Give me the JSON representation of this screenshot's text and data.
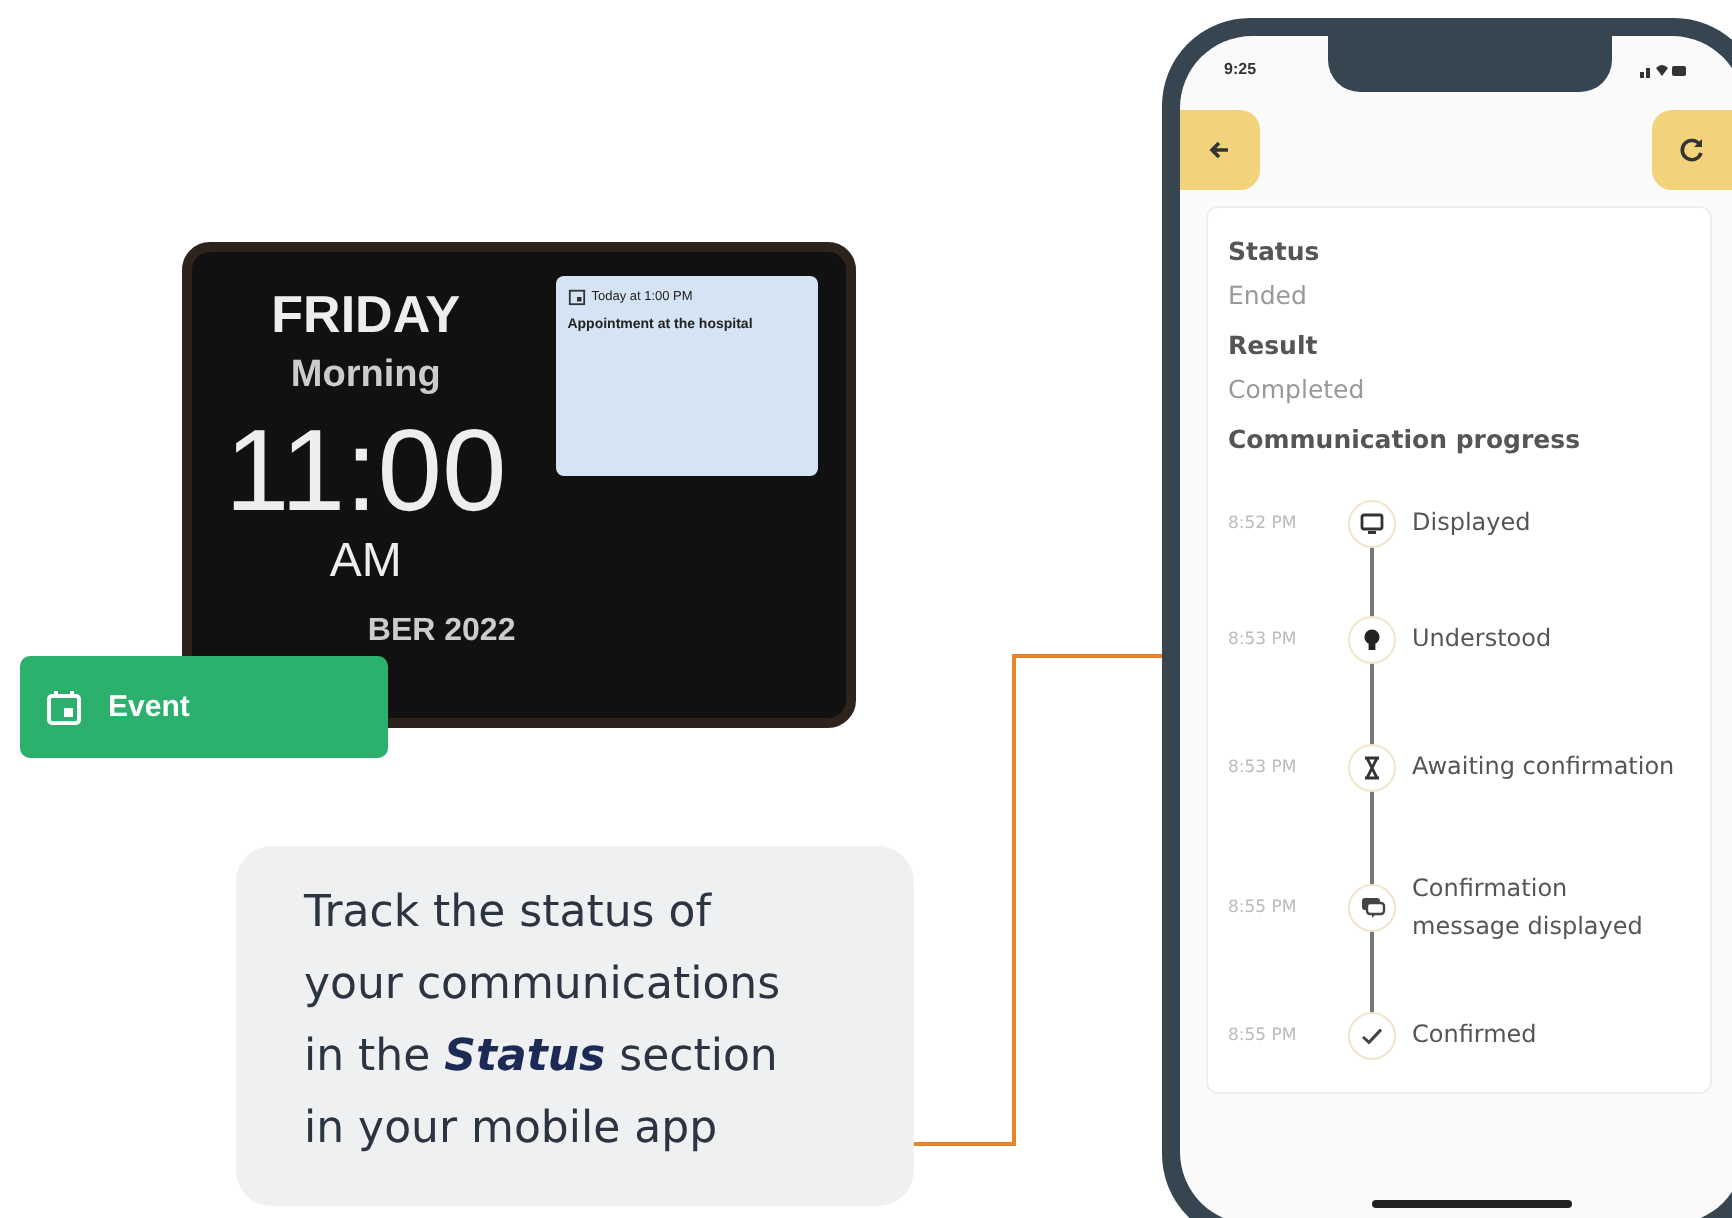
{
  "tablet": {
    "day": "FRIDAY",
    "period": "Morning",
    "time": "11:00",
    "meridiem": "AM",
    "date": "BER 2022",
    "event": {
      "when": "Today at 1:00 PM",
      "title": "Appointment at the hospital"
    }
  },
  "event_badge": {
    "label": "Event"
  },
  "callout": {
    "text": "Track the status of your communications in the **Status** section in your mobile app"
  },
  "phone": {
    "clock": "9:25",
    "fields": [
      {
        "label": "Status",
        "value": "Ended"
      },
      {
        "label": "Result",
        "value": "Completed"
      }
    ],
    "progress_title": "Communication progress",
    "steps": [
      {
        "time": "8:52 PM",
        "kind": "monitor",
        "label": "Displayed"
      },
      {
        "time": "8:53 PM",
        "kind": "bulb",
        "label": "Understood"
      },
      {
        "time": "8:53 PM",
        "kind": "hourglass",
        "label": "Awaiting confirmation"
      },
      {
        "time": "8:55 PM",
        "kind": "chat",
        "label": "Confirmation message displayed"
      },
      {
        "time": "8:55 PM",
        "kind": "check",
        "label": "Confirmed"
      }
    ]
  }
}
